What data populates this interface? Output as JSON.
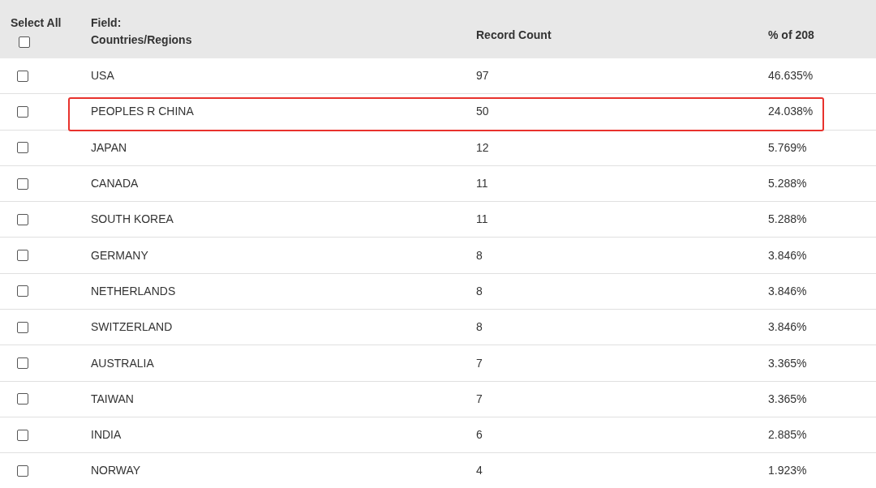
{
  "header": {
    "select_all": {
      "label": "Select All",
      "checked": false
    },
    "field_label": "Field:",
    "field_name": "Countries/Regions",
    "count_label": "Record Count",
    "percent_label": "% of 208"
  },
  "rows": [
    {
      "name": "USA",
      "count": "97",
      "percent": "46.635%",
      "checked": false,
      "highlighted": false
    },
    {
      "name": "PEOPLES R CHINA",
      "count": "50",
      "percent": "24.038%",
      "checked": false,
      "highlighted": true
    },
    {
      "name": "JAPAN",
      "count": "12",
      "percent": "5.769%",
      "checked": false,
      "highlighted": false
    },
    {
      "name": "CANADA",
      "count": "11",
      "percent": "5.288%",
      "checked": false,
      "highlighted": false
    },
    {
      "name": "SOUTH KOREA",
      "count": "11",
      "percent": "5.288%",
      "checked": false,
      "highlighted": false
    },
    {
      "name": "GERMANY",
      "count": "8",
      "percent": "3.846%",
      "checked": false,
      "highlighted": false
    },
    {
      "name": "NETHERLANDS",
      "count": "8",
      "percent": "3.846%",
      "checked": false,
      "highlighted": false
    },
    {
      "name": "SWITZERLAND",
      "count": "8",
      "percent": "3.846%",
      "checked": false,
      "highlighted": false
    },
    {
      "name": "AUSTRALIA",
      "count": "7",
      "percent": "3.365%",
      "checked": false,
      "highlighted": false
    },
    {
      "name": "TAIWAN",
      "count": "7",
      "percent": "3.365%",
      "checked": false,
      "highlighted": false
    },
    {
      "name": "INDIA",
      "count": "6",
      "percent": "2.885%",
      "checked": false,
      "highlighted": false
    },
    {
      "name": "NORWAY",
      "count": "4",
      "percent": "1.923%",
      "checked": false,
      "highlighted": false
    }
  ]
}
